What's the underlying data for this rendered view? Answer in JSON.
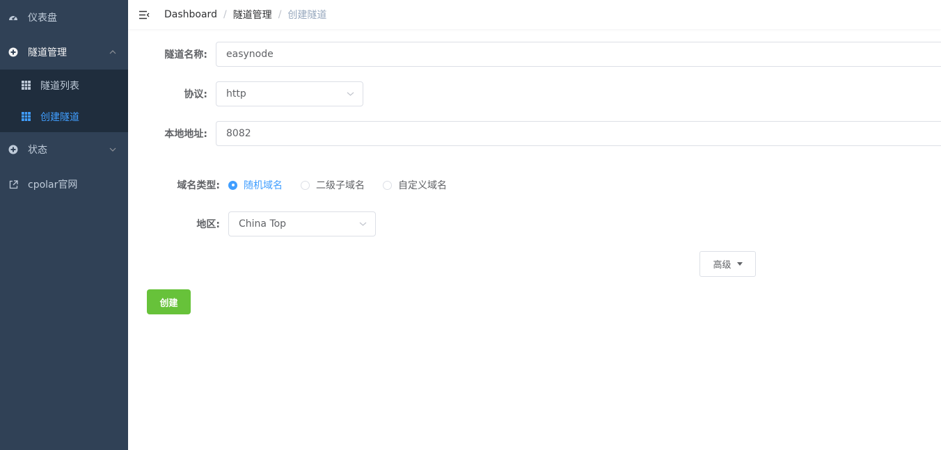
{
  "sidebar": {
    "dashboard": "仪表盘",
    "tunnel_mgmt": "隧道管理",
    "tunnel_list": "隧道列表",
    "create_tunnel": "创建隧道",
    "status": "状态",
    "cpolar_site": "cpolar官网"
  },
  "breadcrumb": {
    "items": [
      "Dashboard",
      "隧道管理",
      "创建隧道"
    ],
    "separator": "/"
  },
  "form": {
    "tunnel_name_label": "隧道名称:",
    "tunnel_name_value": "easynode",
    "protocol_label": "协议:",
    "protocol_value": "http",
    "local_addr_label": "本地地址:",
    "local_addr_value": "8082",
    "domain_type_label": "域名类型:",
    "domain_types": [
      "随机域名",
      "二级子域名",
      "自定义域名"
    ],
    "region_label": "地区:",
    "region_value": "China Top",
    "advanced_button": "高级",
    "create_button": "创建"
  },
  "colors": {
    "sidebar_bg": "#304156",
    "submenu_bg": "#1f2d3d",
    "active": "#409eff",
    "create_button": "#67c23a"
  }
}
